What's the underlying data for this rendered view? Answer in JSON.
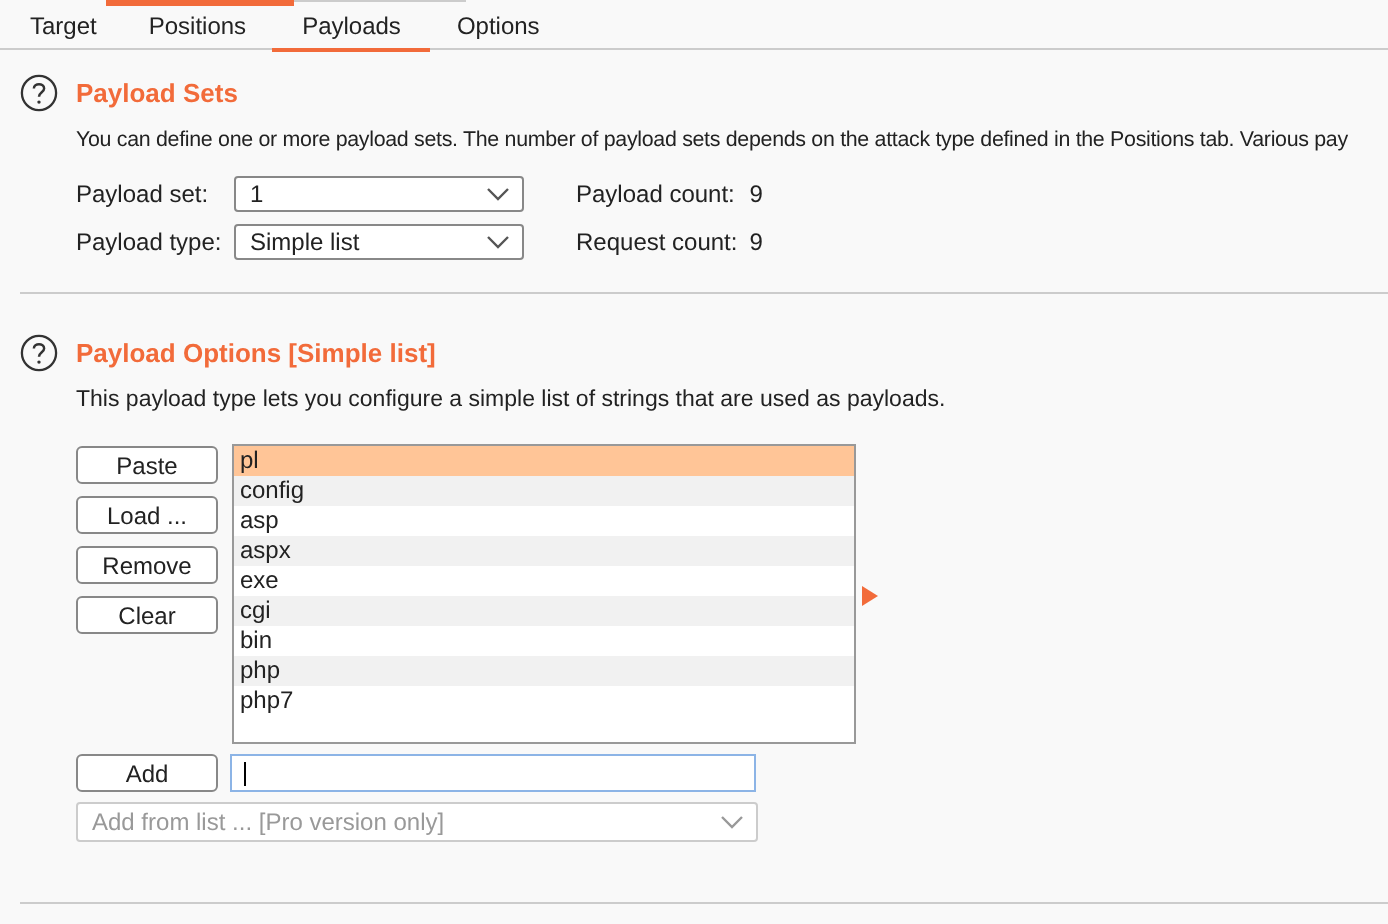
{
  "tabs": [
    {
      "label": "Target",
      "selected": false
    },
    {
      "label": "Positions",
      "selected": false
    },
    {
      "label": "Payloads",
      "selected": true
    },
    {
      "label": "Options",
      "selected": false
    }
  ],
  "payload_sets": {
    "title": "Payload Sets",
    "description": "You can define one or more payload sets. The number of payload sets depends on the attack type defined in the Positions tab. Various pay",
    "fields": [
      {
        "label": "Payload set:",
        "value": "1"
      },
      {
        "label": "Payload type:",
        "value": "Simple list"
      }
    ],
    "counts": [
      {
        "label": "Payload count:",
        "value": "9"
      },
      {
        "label": "Request count:",
        "value": "9"
      }
    ]
  },
  "payload_options": {
    "title": "Payload Options [Simple list]",
    "description": "This payload type lets you configure a simple list of strings that are used as payloads.",
    "buttons": [
      "Paste",
      "Load ...",
      "Remove",
      "Clear"
    ],
    "items": [
      {
        "text": "pl",
        "selected": true
      },
      {
        "text": "config",
        "selected": false
      },
      {
        "text": "asp",
        "selected": false
      },
      {
        "text": "aspx",
        "selected": false
      },
      {
        "text": "exe",
        "selected": false
      },
      {
        "text": "cgi",
        "selected": false
      },
      {
        "text": "bin",
        "selected": false
      },
      {
        "text": "php",
        "selected": false
      },
      {
        "text": "php7",
        "selected": false
      }
    ],
    "add_button": "Add",
    "add_from_list": {
      "value": "Add from list ... [Pro version only]",
      "disabled": true
    }
  }
}
